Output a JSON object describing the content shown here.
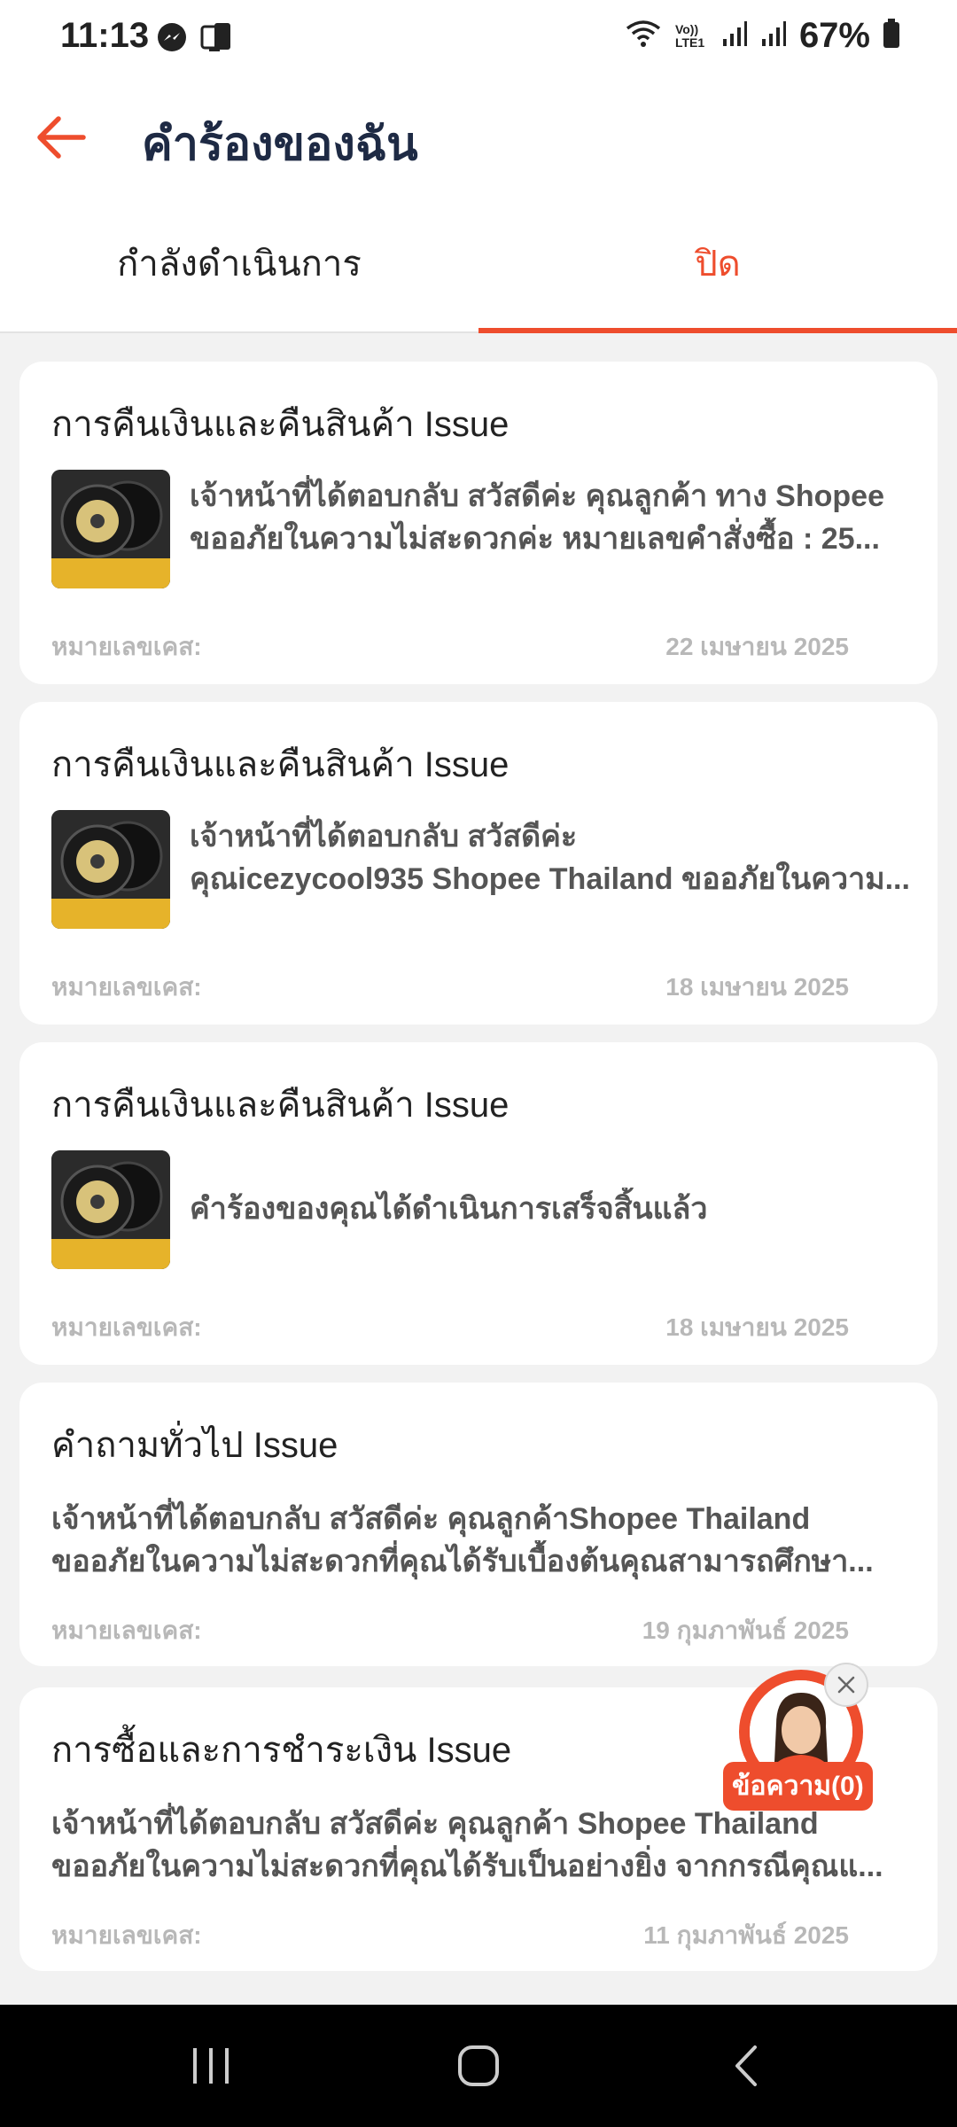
{
  "status_bar": {
    "time": "11:13",
    "network_label": "Vo)) LTE1",
    "battery": "67%"
  },
  "header": {
    "title": "คำร้องของฉัน",
    "back_icon": "arrow-left-icon"
  },
  "tabs": [
    {
      "label": "กำลังดำเนินการ",
      "active": false
    },
    {
      "label": "ปิด",
      "active": true
    }
  ],
  "colors": {
    "accent": "#ee4d2d",
    "title": "#1e2a44",
    "background": "#f2f2f2"
  },
  "cases": [
    {
      "title": "การคืนเงินและคืนสินค้า Issue",
      "message_line1": "เจ้าหน้าที่ได้ตอบกลับ สวัสดีค่ะ คุณลูกค้า  ทาง Shopee",
      "message_line2": "ขออภัยในความไม่สะดวกค่ะ  หมายเลขคำสั่งซื้อ : 25...",
      "case_label": "หมายเลขเคส:",
      "date": "22 เมษายน 2025",
      "has_thumb": true
    },
    {
      "title": "การคืนเงินและคืนสินค้า Issue",
      "message_line1": "เจ้าหน้าที่ได้ตอบกลับ  สวัสดีค่ะ",
      "message_line2": "คุณicezycool935 Shopee Thailand ขออภัยในความ...",
      "case_label": "หมายเลขเคส:",
      "date": "18 เมษายน 2025",
      "has_thumb": true
    },
    {
      "title": "การคืนเงินและคืนสินค้า Issue",
      "message_line1": "คำร้องของคุณได้ดำเนินการเสร็จสิ้นแล้ว",
      "message_line2": "",
      "case_label": "หมายเลขเคส:",
      "date": "18 เมษายน 2025",
      "has_thumb": true
    },
    {
      "title": "คำถามทั่วไป Issue",
      "message_line1": "เจ้าหน้าที่ได้ตอบกลับ สวัสดีค่ะ คุณลูกค้าShopee Thailand",
      "message_line2": "ขออภัยในความไม่สะดวกที่คุณได้รับเบื้องต้นคุณสามารถศึกษา...",
      "case_label": "หมายเลขเคส:",
      "date": "19 กุมภาพันธ์ 2025",
      "has_thumb": false
    },
    {
      "title": "การซื้อและการชำระเงิน Issue",
      "message_line1": "เจ้าหน้าที่ได้ตอบกลับ  สวัสดีค่ะ คุณลูกค้า   Shopee Thailand",
      "message_line2": "ขออภัยในความไม่สะดวกที่คุณได้รับเป็นอย่างยิ่ง จากกรณีคุณแ...",
      "case_label": "หมายเลขเคส:",
      "date": "11 กุมภาพันธ์ 2025",
      "has_thumb": false
    }
  ],
  "floating_chat": {
    "label": "ข้อความ(0)"
  }
}
